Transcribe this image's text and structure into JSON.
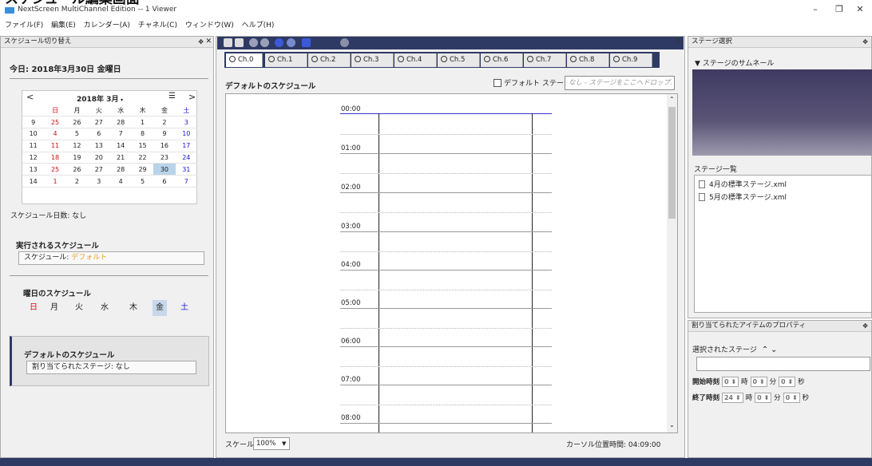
{
  "page_heading": "スケジュール編集画面",
  "window": {
    "title": "NextScreen MultiChannel Edition -- 1 Viewer",
    "minimize": "–",
    "maximize": "❐",
    "close": "✕"
  },
  "menu": [
    "ファイル(F)",
    "編集(E)",
    "カレンダー(A)",
    "チャネル(C)",
    "ウィンドウ(W)",
    "ヘルプ(H)"
  ],
  "left_panel": {
    "title": "スケジュール切り替え",
    "today": "今日: 2018年3月30日 金曜日",
    "calendar": {
      "month_label": "2018年  3月",
      "prev": "<",
      "next": ">",
      "menu": "☰",
      "weekdays": [
        "日",
        "月",
        "火",
        "水",
        "木",
        "金",
        "土"
      ],
      "weeks": [
        {
          "wk": "9",
          "days": [
            "25",
            "26",
            "27",
            "28",
            "1",
            "2",
            "3"
          ]
        },
        {
          "wk": "10",
          "days": [
            "4",
            "5",
            "6",
            "7",
            "8",
            "9",
            "10"
          ]
        },
        {
          "wk": "11",
          "days": [
            "11",
            "12",
            "13",
            "14",
            "15",
            "16",
            "17"
          ]
        },
        {
          "wk": "12",
          "days": [
            "18",
            "19",
            "20",
            "21",
            "22",
            "23",
            "24"
          ]
        },
        {
          "wk": "13",
          "days": [
            "25",
            "26",
            "27",
            "28",
            "29",
            "30",
            "31"
          ]
        },
        {
          "wk": "14",
          "days": [
            "1",
            "2",
            "3",
            "4",
            "5",
            "6",
            "7"
          ]
        }
      ],
      "selected": "30"
    },
    "schedule_days": "スケジュール日数: なし",
    "executed_header": "実行されるスケジュール",
    "executed_label": "スケジュール: ",
    "executed_value": "デフォルト",
    "weekday_header": "曜日のスケジュール",
    "weekday_buttons": [
      "日",
      "月",
      "火",
      "水",
      "木",
      "金",
      "土"
    ],
    "default_header": "デフォルトのスケジュール",
    "assigned_stage": "割り当てられたステージ: なし"
  },
  "center": {
    "close": "✕",
    "channels": [
      "Ch.0",
      "Ch.1",
      "Ch.2",
      "Ch.3",
      "Ch.4",
      "Ch.5",
      "Ch.6",
      "Ch.7",
      "Ch.8",
      "Ch.9"
    ],
    "schedule_title": "デフォルトのスケジュール",
    "default_stage_checkbox": "デフォルト ステージ",
    "drop_placeholder": "なし - ステージをここへドロップ.",
    "times": [
      "00:00",
      "01:00",
      "02:00",
      "03:00",
      "04:00",
      "05:00",
      "06:00",
      "07:00",
      "08:00"
    ],
    "scale_label": "スケール",
    "scale_value": "100%",
    "cursor_time": "カーソル位置時間: 04:09:00"
  },
  "stage_panel": {
    "title": "ステージ選択",
    "thumbnail_header": "▼ ステージのサムネール",
    "list_header": "ステージ一覧",
    "items": [
      "4月の標準ステージ.xml",
      "5月の標準ステージ.xml"
    ]
  },
  "props_panel": {
    "title": "割り当てられたアイテムのプロパティ",
    "selected_stage": "選択されたステージ",
    "start_label": "開始時刻",
    "end_label": "終了時刻",
    "start": {
      "h": "0",
      "m": "0",
      "s": "0"
    },
    "end": {
      "h": "24",
      "m": "0",
      "s": "0"
    },
    "hour_unit": "時",
    "min_unit": "分",
    "sec_unit": "秒"
  },
  "colors": {
    "accent": "#2e3a64",
    "holiday": "#d01010",
    "saturday": "#1a1ad0",
    "timeline": "#3333cc"
  }
}
